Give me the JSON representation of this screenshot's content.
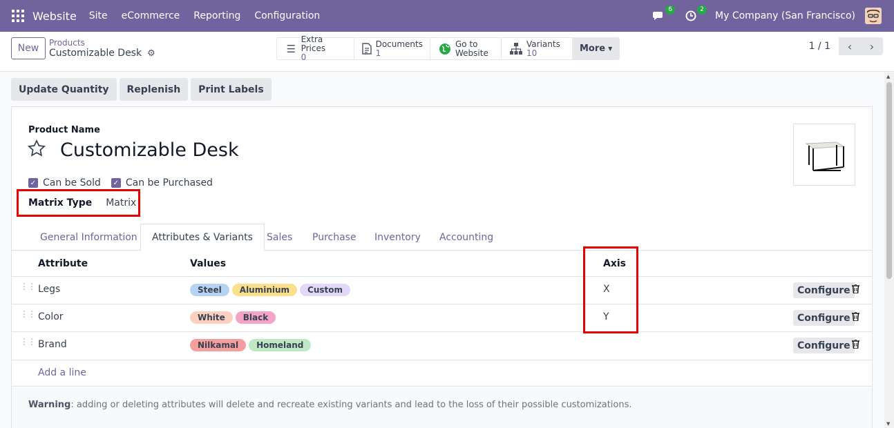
{
  "topbar": {
    "app_name": "Website",
    "menu": [
      "Site",
      "eCommerce",
      "Reporting",
      "Configuration"
    ],
    "chat_badge": "6",
    "activity_badge": "2",
    "company": "My Company (San Francisco)"
  },
  "control": {
    "new_label": "New",
    "breadcrumb_parent": "Products",
    "breadcrumb_current": "Customizable Desk",
    "smart_buttons": [
      {
        "label": "Extra Prices",
        "value": "0",
        "icon": "list-icon"
      },
      {
        "label": "Documents",
        "value": "1",
        "icon": "document-icon"
      },
      {
        "label": "Go to",
        "value": "Website",
        "icon": "globe-icon"
      },
      {
        "label": "Variants",
        "value": "10",
        "icon": "sitemap-icon"
      }
    ],
    "more_label": "More",
    "pager": "1 / 1"
  },
  "actions": [
    "Update Quantity",
    "Replenish",
    "Print Labels"
  ],
  "form": {
    "product_name_label": "Product Name",
    "product_name": "Customizable Desk",
    "can_be_sold": "Can be Sold",
    "can_be_purchased": "Can be Purchased",
    "matrix_type_label": "Matrix Type",
    "matrix_type_value": "Matrix"
  },
  "tabs": [
    "General Information",
    "Attributes & Variants",
    "Sales",
    "Purchase",
    "Inventory",
    "Accounting"
  ],
  "table": {
    "headers": {
      "attribute": "Attribute",
      "values": "Values",
      "axis": "Axis"
    },
    "rows": [
      {
        "attribute": "Legs",
        "values": [
          "Steel",
          "Aluminium",
          "Custom"
        ],
        "axis": "X"
      },
      {
        "attribute": "Color",
        "values": [
          "White",
          "Black"
        ],
        "axis": "Y"
      },
      {
        "attribute": "Brand",
        "values": [
          "Nilkamal",
          "Homeland"
        ],
        "axis": ""
      }
    ],
    "configure_label": "Configure",
    "add_line": "Add a line"
  },
  "warning": {
    "bold": "Warning",
    "text": ": adding or deleting attributes will delete and recreate existing variants and lead to the loss of their possible customizations."
  },
  "colors": {
    "brand": "#71639e",
    "highlight": "#e60000",
    "tag_steel": "#b6d4f2",
    "tag_aluminium": "#fbe08c",
    "tag_custom": "#e3d8f7",
    "tag_white": "#fbd0c0",
    "tag_black": "#f4a3c9",
    "tag_nilkamal": "#f49e9e",
    "tag_homeland": "#bfe8c4"
  }
}
